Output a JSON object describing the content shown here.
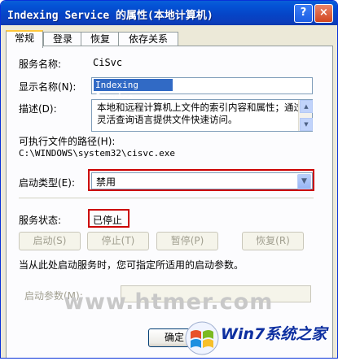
{
  "window": {
    "title": "Indexing Service 的属性(本地计算机)",
    "help_glyph": "?",
    "close_glyph": "×"
  },
  "tabs": [
    {
      "label": "常规",
      "active": true
    },
    {
      "label": "登录",
      "active": false
    },
    {
      "label": "恢复",
      "active": false
    },
    {
      "label": "依存关系",
      "active": false
    }
  ],
  "general": {
    "service_name_label": "服务名称:",
    "service_name_value": "CiSvc",
    "display_name_label": "显示名称(N):",
    "display_name_value": "Indexing Service",
    "description_label": "描述(D):",
    "description_value": "本地和远程计算机上文件的索引内容和属性；通过灵活查询语言提供文件快速访问。",
    "path_label": "可执行文件的路径(H):",
    "path_value": "C:\\WINDOWS\\system32\\cisvc.exe",
    "startup_type_label": "启动类型(E):",
    "startup_type_value": "禁用",
    "status_label": "服务状态:",
    "status_value": "已停止",
    "buttons": {
      "start": "启动(S)",
      "stop": "停止(T)",
      "pause": "暂停(P)",
      "resume": "恢复(R)"
    },
    "hint": "当从此处启动服务时，您可指定所适用的启动参数。",
    "params_label": "启动参数(M):",
    "params_value": ""
  },
  "footer": {
    "ok_label": "确定"
  },
  "watermark": {
    "site": "www.htmer.com",
    "logo_text": "Win7系统之家"
  },
  "colors": {
    "titlebar": "#0453d6",
    "highlight": "#316ac5",
    "annotation_red": "#cc0000",
    "dialog_bg": "#ece9d8"
  }
}
